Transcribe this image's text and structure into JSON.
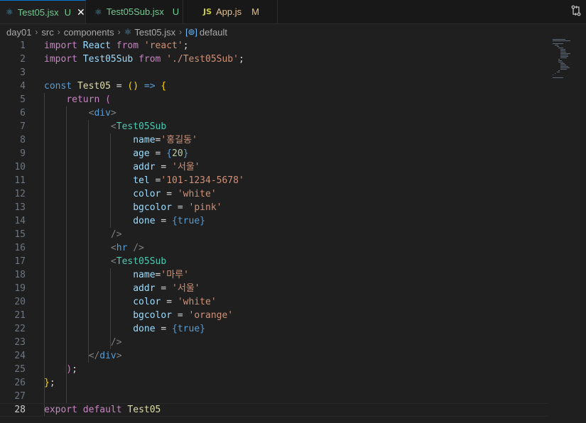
{
  "tabs": [
    {
      "name": "Test05.jsx",
      "status": "U",
      "icon": "react-icon",
      "active": true,
      "state": "untracked"
    },
    {
      "name": "Test05Sub.jsx",
      "status": "U",
      "icon": "react-icon",
      "active": false,
      "state": "untracked"
    },
    {
      "name": "App.js",
      "status": "M",
      "icon": "js-icon",
      "active": false,
      "state": "modified"
    }
  ],
  "tab_close_glyph": "✕",
  "js_icon_label": "JS",
  "breadcrumb": {
    "items": [
      "day01",
      "src",
      "components",
      "Test05.jsx",
      "default"
    ],
    "separator": "›"
  },
  "editor": {
    "current_line": 28,
    "line_numbers": [
      "1",
      "2",
      "3",
      "4",
      "5",
      "6",
      "7",
      "8",
      "9",
      "10",
      "11",
      "12",
      "13",
      "14",
      "15",
      "16",
      "17",
      "18",
      "19",
      "20",
      "21",
      "22",
      "23",
      "24",
      "25",
      "26",
      "27",
      "28"
    ]
  },
  "code_lines": [
    [
      [
        "kw",
        "import"
      ],
      [
        "pn",
        " "
      ],
      [
        "vn",
        "React"
      ],
      [
        "pn",
        " "
      ],
      [
        "kw",
        "from"
      ],
      [
        "pn",
        " "
      ],
      [
        "st",
        "'react'"
      ],
      [
        "pn",
        ";"
      ]
    ],
    [
      [
        "kw",
        "import"
      ],
      [
        "pn",
        " "
      ],
      [
        "vn",
        "Test05Sub"
      ],
      [
        "pn",
        " "
      ],
      [
        "kw",
        "from"
      ],
      [
        "pn",
        " "
      ],
      [
        "st",
        "'./Test05Sub'"
      ],
      [
        "pn",
        ";"
      ]
    ],
    [],
    [
      [
        "kb",
        "const"
      ],
      [
        "pn",
        " "
      ],
      [
        "fn",
        "Test05"
      ],
      [
        "pn",
        " = "
      ],
      [
        "br1",
        "()"
      ],
      [
        "pn",
        " "
      ],
      [
        "kb",
        "=>"
      ],
      [
        "pn",
        " "
      ],
      [
        "br1",
        "{"
      ]
    ],
    [
      [
        "pn",
        "    "
      ],
      [
        "kw",
        "return"
      ],
      [
        "pn",
        " "
      ],
      [
        "br2",
        "("
      ]
    ],
    [
      [
        "pn",
        "        "
      ],
      [
        "tgb",
        "<"
      ],
      [
        "kb",
        "div"
      ],
      [
        "tgb",
        ">"
      ]
    ],
    [
      [
        "pn",
        "            "
      ],
      [
        "tgb",
        "<"
      ],
      [
        "tg",
        "Test05Sub"
      ]
    ],
    [
      [
        "pn",
        "                "
      ],
      [
        "vn",
        "name"
      ],
      [
        "pn",
        "="
      ],
      [
        "st",
        "'홍길동'"
      ]
    ],
    [
      [
        "pn",
        "                "
      ],
      [
        "vn",
        "age"
      ],
      [
        "pn",
        " = "
      ],
      [
        "kb",
        "{"
      ],
      [
        "nm",
        "20"
      ],
      [
        "kb",
        "}"
      ]
    ],
    [
      [
        "pn",
        "                "
      ],
      [
        "vn",
        "addr"
      ],
      [
        "pn",
        " = "
      ],
      [
        "st",
        "'서울'"
      ]
    ],
    [
      [
        "pn",
        "                "
      ],
      [
        "vn",
        "tel"
      ],
      [
        "pn",
        " ="
      ],
      [
        "st",
        "'101-1234-5678'"
      ]
    ],
    [
      [
        "pn",
        "                "
      ],
      [
        "vn",
        "color"
      ],
      [
        "pn",
        " = "
      ],
      [
        "st",
        "'white'"
      ]
    ],
    [
      [
        "pn",
        "                "
      ],
      [
        "vn",
        "bgcolor"
      ],
      [
        "pn",
        " = "
      ],
      [
        "st",
        "'pink'"
      ]
    ],
    [
      [
        "pn",
        "                "
      ],
      [
        "vn",
        "done"
      ],
      [
        "pn",
        " = "
      ],
      [
        "kb",
        "{true}"
      ]
    ],
    [
      [
        "pn",
        "            "
      ],
      [
        "tgb",
        "/>"
      ]
    ],
    [
      [
        "pn",
        "            "
      ],
      [
        "tgb",
        "<"
      ],
      [
        "kb",
        "hr"
      ],
      [
        "pn",
        " "
      ],
      [
        "tgb",
        "/>"
      ]
    ],
    [
      [
        "pn",
        "            "
      ],
      [
        "tgb",
        "<"
      ],
      [
        "tg",
        "Test05Sub"
      ]
    ],
    [
      [
        "pn",
        "                "
      ],
      [
        "vn",
        "name"
      ],
      [
        "pn",
        "="
      ],
      [
        "st",
        "'마루'"
      ]
    ],
    [
      [
        "pn",
        "                "
      ],
      [
        "vn",
        "addr"
      ],
      [
        "pn",
        " = "
      ],
      [
        "st",
        "'서울'"
      ]
    ],
    [
      [
        "pn",
        "                "
      ],
      [
        "vn",
        "color"
      ],
      [
        "pn",
        " = "
      ],
      [
        "st",
        "'white'"
      ]
    ],
    [
      [
        "pn",
        "                "
      ],
      [
        "vn",
        "bgcolor"
      ],
      [
        "pn",
        " = "
      ],
      [
        "st",
        "'orange'"
      ]
    ],
    [
      [
        "pn",
        "                "
      ],
      [
        "vn",
        "done"
      ],
      [
        "pn",
        " = "
      ],
      [
        "kb",
        "{true}"
      ]
    ],
    [
      [
        "pn",
        "            "
      ],
      [
        "tgb",
        "/>"
      ]
    ],
    [
      [
        "pn",
        "        "
      ],
      [
        "tgb",
        "</"
      ],
      [
        "kb",
        "div"
      ],
      [
        "tgb",
        ">"
      ]
    ],
    [
      [
        "pn",
        "    "
      ],
      [
        "br2",
        ")"
      ],
      [
        "pn",
        ";"
      ]
    ],
    [
      [
        "br1",
        "}"
      ],
      [
        "pn",
        ";"
      ]
    ],
    [],
    [
      [
        "kw",
        "export"
      ],
      [
        "pn",
        " "
      ],
      [
        "kw",
        "default"
      ],
      [
        "pn",
        " "
      ],
      [
        "fn",
        "Test05"
      ]
    ]
  ]
}
